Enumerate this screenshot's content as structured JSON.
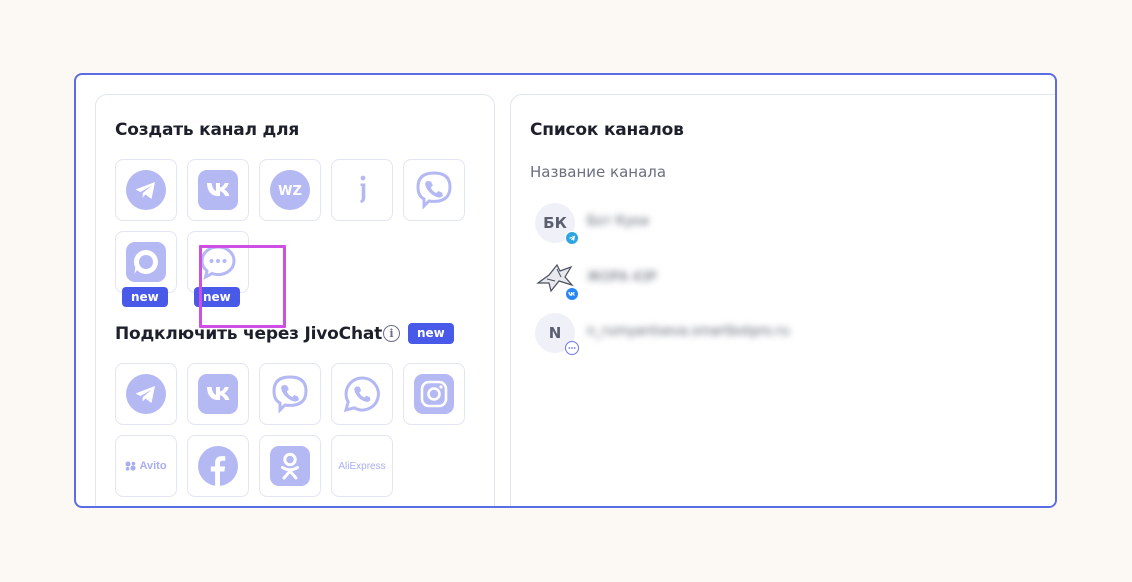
{
  "colors": {
    "frame": "#5c6be6",
    "accent": "#4a5ae8",
    "icon": "#b4b8f3",
    "highlight": "#cf4ee6"
  },
  "create_section": {
    "title": "Создать канал для",
    "tiles": [
      {
        "icon": "telegram-icon"
      },
      {
        "icon": "vk-icon"
      },
      {
        "icon": "wazzup-icon",
        "text": "WZ"
      },
      {
        "icon": "jivo-icon",
        "text": "j"
      },
      {
        "icon": "viber-icon"
      },
      {
        "icon": "max-messenger-icon",
        "badge": "new"
      },
      {
        "icon": "chat-widget-icon",
        "badge": "new"
      }
    ]
  },
  "jivo_section": {
    "title": "Подключить через JivoChat",
    "info": "i",
    "badge": "new",
    "tiles": [
      {
        "icon": "telegram-icon"
      },
      {
        "icon": "vk-icon"
      },
      {
        "icon": "viber-icon"
      },
      {
        "icon": "whatsapp-icon"
      },
      {
        "icon": "instagram-icon"
      },
      {
        "icon": "avito-icon",
        "text": "Avito"
      },
      {
        "icon": "facebook-icon"
      },
      {
        "icon": "odnoklassniki-icon"
      },
      {
        "icon": "aliexpress-icon",
        "text": "AliExpress"
      }
    ]
  },
  "channels": {
    "title": "Список каналов",
    "column_header": "Название канала",
    "rows": [
      {
        "avatar": "БК",
        "name": "Бот Куки",
        "channel_icon": "telegram-icon"
      },
      {
        "avatar": "",
        "name": "ЖОРА 43Р",
        "channel_icon": "vk-icon"
      },
      {
        "avatar": "N",
        "name": "n_rumyantseva.smartbotpro.ru",
        "channel_icon": "chat-widget-icon"
      }
    ]
  }
}
